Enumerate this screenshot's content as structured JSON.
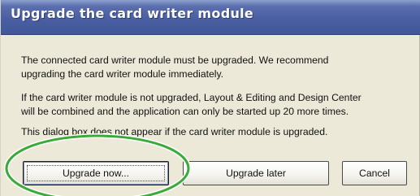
{
  "dialog": {
    "title": "Upgrade the card writer module",
    "paragraphs": [
      [
        "The connected card writer module must be upgraded. We recommend",
        "upgrading the card writer module immediately."
      ],
      [
        "If the card writer module is not upgraded, Layout & Editing and Design Center",
        "will be combined and the application can only be started up 20 more times."
      ],
      [
        "This dialog box does not appear if the card writer module is upgraded."
      ]
    ],
    "buttons": {
      "upgrade_now": "Upgrade now...",
      "upgrade_later": "Upgrade later",
      "cancel": "Cancel"
    }
  },
  "colors": {
    "titlebar": "#4a5fa2",
    "dialog_bg": "#ece9d8",
    "highlight": "#3aaa3a"
  },
  "icons": {
    "highlight": "green-ellipse-annotation"
  }
}
